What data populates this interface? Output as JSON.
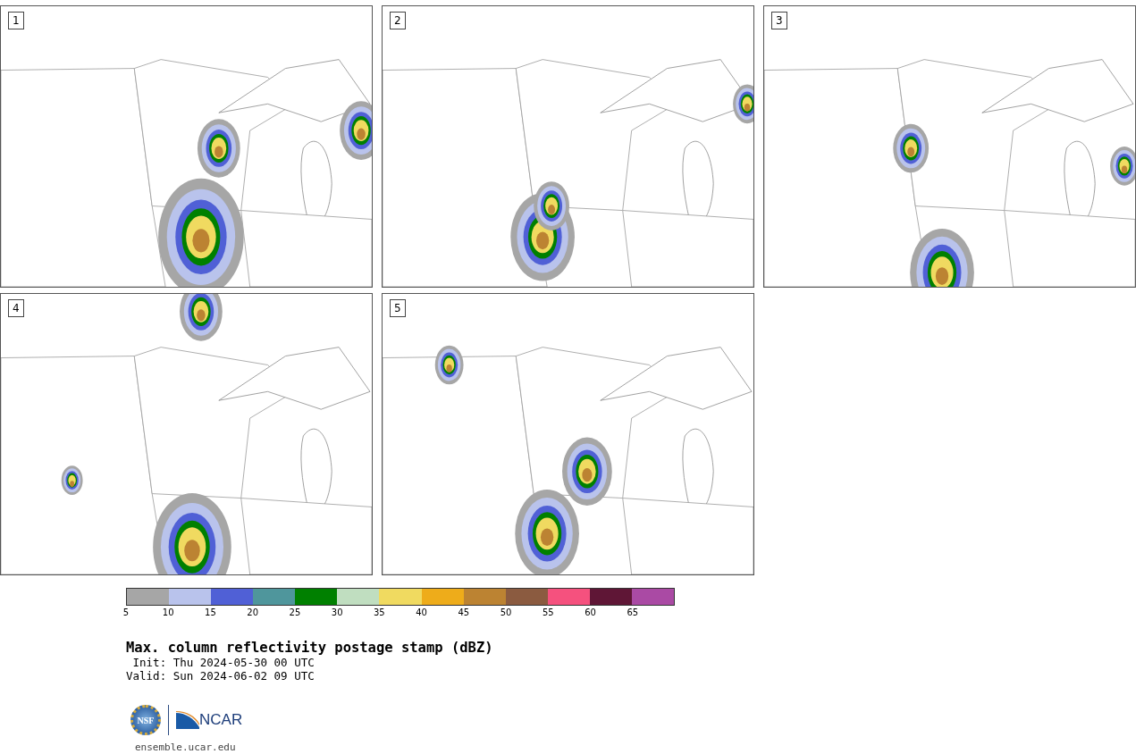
{
  "panels": [
    {
      "label": "1"
    },
    {
      "label": "2"
    },
    {
      "label": "3"
    },
    {
      "label": "4"
    },
    {
      "label": "5"
    }
  ],
  "colorbar": {
    "segments": [
      {
        "color": "#a6a6a6"
      },
      {
        "color": "#b9c3ec"
      },
      {
        "color": "#5060d6"
      },
      {
        "color": "#4f969c"
      },
      {
        "color": "#008000"
      },
      {
        "color": "#c0dec0"
      },
      {
        "color": "#f0da60"
      },
      {
        "color": "#eeac1a"
      },
      {
        "color": "#bc8332"
      },
      {
        "color": "#8b5b40"
      },
      {
        "color": "#f5517e"
      },
      {
        "color": "#5f1636"
      },
      {
        "color": "#aa4aa4"
      }
    ],
    "ticks": [
      "5",
      "10",
      "15",
      "20",
      "25",
      "30",
      "35",
      "40",
      "45",
      "50",
      "55",
      "60",
      "65"
    ]
  },
  "title": "Max. column reflectivity postage stamp (dBZ)",
  "init": " Init: Thu 2024-05-30 00 UTC",
  "valid": "Valid: Sun 2024-06-02 09 UTC",
  "logos": {
    "nsf": "NSF",
    "ncar": "NCAR"
  },
  "url": "ensemble.ucar.edu"
}
